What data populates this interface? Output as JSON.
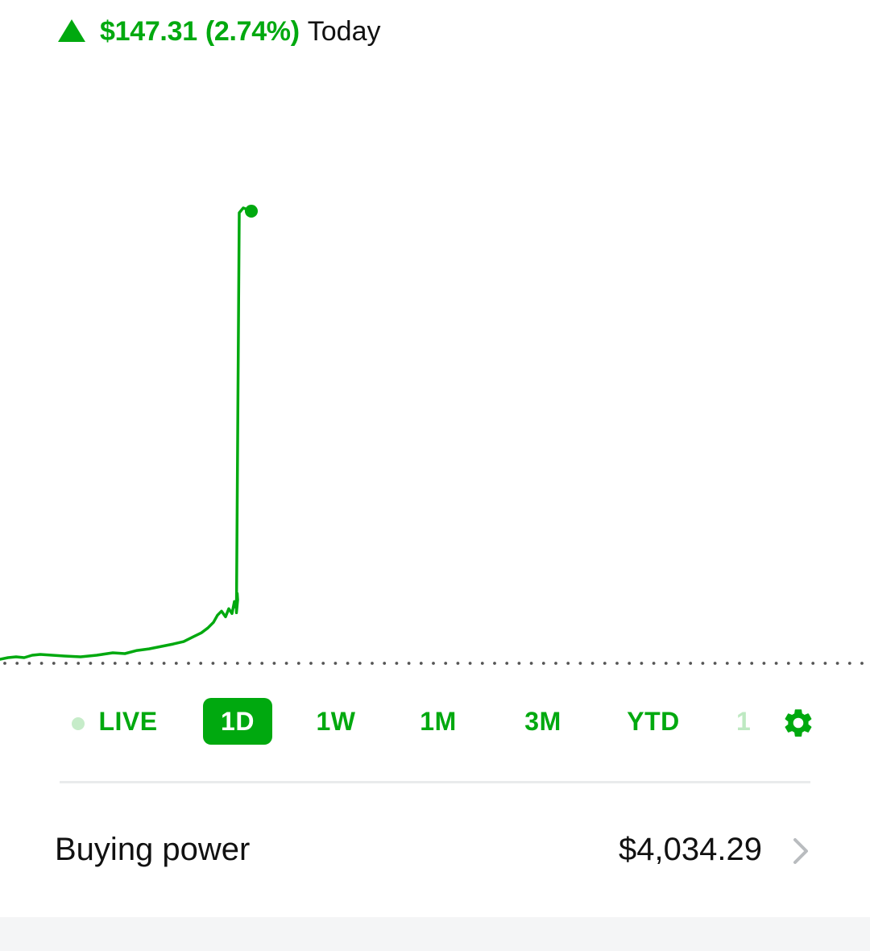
{
  "header": {
    "change_amount": "$147.31",
    "change_percent": "(2.74%)",
    "change_period": "Today",
    "direction_icon": "triangle-up-icon"
  },
  "colors": {
    "accent": "#00a90f",
    "text": "#111111",
    "divider": "#e9ebec",
    "baseline_dots": "#555555",
    "bottom_band": "#f4f5f6"
  },
  "chart_data": {
    "type": "line",
    "title": "",
    "xlabel": "",
    "ylabel": "",
    "baseline": "previous close (dotted line)",
    "grid": false,
    "series": [
      {
        "values": [
          0.0,
          0.02,
          0.03,
          0.02,
          0.05,
          0.06,
          0.05,
          0.04,
          0.03,
          0.05,
          0.08,
          0.07,
          0.11,
          0.13,
          0.16,
          0.19,
          0.22,
          0.28,
          0.33,
          0.39,
          0.46,
          0.55,
          0.6,
          0.53,
          0.63,
          0.57,
          0.72,
          0.64,
          0.82,
          0.74,
          0.58,
          5.57,
          5.63,
          5.59
        ],
        "end_marker": true
      }
    ]
  },
  "ranges": {
    "live_label": "LIVE",
    "items": [
      "1D",
      "1W",
      "1M",
      "3M",
      "YTD"
    ],
    "active": "1D",
    "overflow_label": "1",
    "settings_icon": "gear-icon"
  },
  "buying_power": {
    "label": "Buying power",
    "value": "$4,034.29",
    "chevron_icon": "chevron-right-icon"
  }
}
